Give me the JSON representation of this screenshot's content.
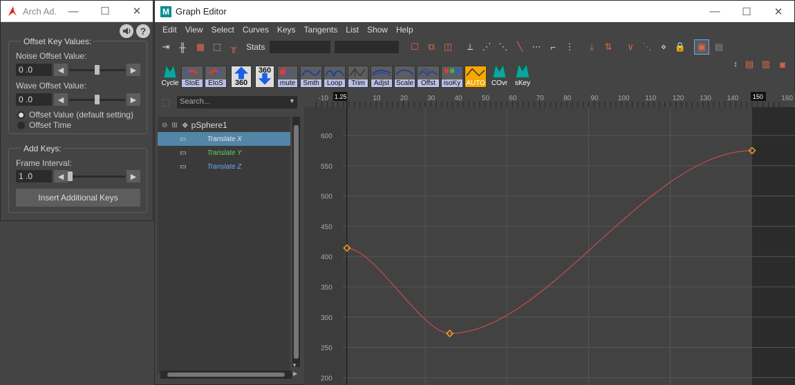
{
  "arch_window": {
    "title": "Arch Ad...",
    "offset_group": {
      "title": "Offset Key Values:",
      "noise_label": "Noise Offset Value:",
      "noise_value": "0 .0",
      "noise_slider_level": 0.5,
      "wave_label": "Wave Offset Value:",
      "wave_value": "0 .0",
      "wave_slider_level": 0.5,
      "radio_offset_value": "Offset Value (default setting)",
      "radio_offset_time": "Offset Time",
      "selected_radio": "offset_value"
    },
    "add_keys_group": {
      "title": "Add Keys:",
      "frame_interval_label": "Frame Interval:",
      "frame_interval_value": "1 .0",
      "frame_slider_level": 0.0,
      "insert_button": "Insert Additional Keys"
    },
    "help_icon": "?"
  },
  "graph_editor": {
    "title": "Graph Editor",
    "logo": "M",
    "menu": [
      "Edit",
      "View",
      "Select",
      "Curves",
      "Keys",
      "Tangents",
      "List",
      "Show",
      "Help"
    ],
    "stats_label": "Stats",
    "shelf_buttons": [
      "Cycle",
      "StoE",
      "EtoS",
      "360",
      "360",
      "mute",
      "Smth",
      "Loop",
      "Trim",
      "Adjst",
      "Scale",
      "Offst",
      "isoKy",
      "AUTO",
      "COvr",
      "sKey"
    ],
    "search_placeholder": "Search...",
    "outliner": {
      "root": "pSphere1",
      "channels": [
        {
          "label": "Translate X",
          "color": "#e8e8e8",
          "selected": true
        },
        {
          "label": "Translate Y",
          "color": "#5fd35f",
          "selected": false
        },
        {
          "label": "Translate Z",
          "color": "#6aa8ff",
          "selected": false
        }
      ]
    },
    "current_frame": "1.25",
    "end_frame": "150",
    "time_ruler": [
      "-10",
      "10",
      "20",
      "30",
      "40",
      "50",
      "60",
      "70",
      "80",
      "90",
      "100",
      "110",
      "120",
      "130",
      "140",
      "160"
    ],
    "value_ruler": [
      "600",
      "550",
      "500",
      "450",
      "400",
      "350",
      "300",
      "250",
      "200"
    ],
    "curve": {
      "name": "Translate X",
      "color": "#c94a4a",
      "key_color": "#f0a020",
      "keys": [
        [
          1.25,
          414
        ],
        [
          39,
          273
        ],
        [
          150,
          575
        ]
      ]
    },
    "colors": {
      "selection": "#5285a6",
      "auto_button": "#f5a800",
      "shelf_label": "#b9c0e6"
    }
  }
}
